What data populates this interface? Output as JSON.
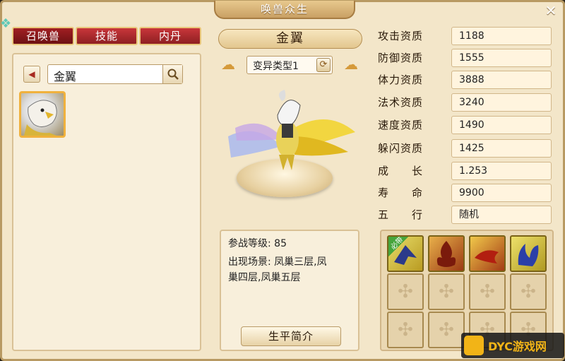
{
  "window": {
    "title": "唤兽众生",
    "close_glyph": "✕"
  },
  "tabs": [
    {
      "label": "召唤兽",
      "active": true
    },
    {
      "label": "技能",
      "active": false
    },
    {
      "label": "内丹",
      "active": false
    }
  ],
  "search": {
    "value": "金翼",
    "back_glyph": "◀"
  },
  "pet": {
    "name": "金翼",
    "variant": "变异类型1",
    "battle_level": "参战等级: 85",
    "location_line1": "出现场景: 凤巢三层,凤",
    "location_line2": "巢四层,凤巢五层",
    "bio_button": "生平简介"
  },
  "stats": [
    {
      "label": "攻击资质",
      "value": "1188"
    },
    {
      "label": "防御资质",
      "value": "1555"
    },
    {
      "label": "体力资质",
      "value": "3888"
    },
    {
      "label": "法术资质",
      "value": "3240"
    },
    {
      "label": "速度资质",
      "value": "1490"
    },
    {
      "label": "躲闪资质",
      "value": "1425"
    },
    {
      "label": "成　　长",
      "value": "1.253"
    },
    {
      "label": "寿　　命",
      "value": "9900"
    },
    {
      "label": "五　　行",
      "value": "随机"
    }
  ],
  "skills": {
    "must_badge": "必带"
  },
  "watermark": {
    "text": "DYC游戏网"
  },
  "colors": {
    "accent": "#a11e22",
    "panel": "#f3e6c9",
    "gold": "#f0b13d"
  }
}
